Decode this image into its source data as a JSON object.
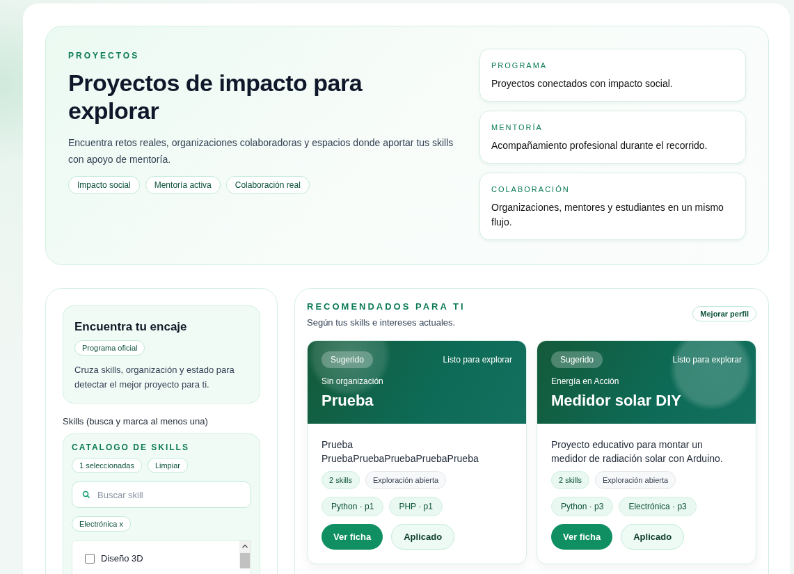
{
  "hero": {
    "eyebrow": "PROYECTOS",
    "title": "Proyectos de impacto para explorar",
    "description": "Encuentra retos reales, organizaciones colaboradoras y espacios donde aportar tus skills con apoyo de mentoría.",
    "tags": [
      "Impacto social",
      "Mentoría activa",
      "Colaboración real"
    ],
    "highlights": [
      {
        "label": "PROGRAMA",
        "text": "Proyectos conectados con impacto social."
      },
      {
        "label": "MENTORÍA",
        "text": "Acompañamiento profesional durante el recorrido."
      },
      {
        "label": "COLABORACIÓN",
        "text": "Organizaciones, mentores y estudiantes en un mismo flujo."
      }
    ]
  },
  "filters": {
    "title": "Encuentra tu encaje",
    "badge": "Programa oficial",
    "description": "Cruza skills, organización y estado para detectar el mejor proyecto para ti.",
    "skills_label": "Skills (busca y marca al menos una)",
    "catalog": {
      "title": "CATALOGO DE SKILLS",
      "selected_count": "1 seleccionadas",
      "clear": "Limpiar",
      "search": {
        "placeholder": "Buscar skill"
      },
      "chips": [
        "Electrónica x"
      ],
      "options": [
        {
          "label": "Diseño 3D",
          "checked": false
        }
      ]
    }
  },
  "recommended": {
    "title": "RECOMENDADOS PARA TI",
    "subtitle": "Según tus skills e intereses actuales.",
    "action": "Mejorar perfil",
    "projects": [
      {
        "badge": "Sugerido",
        "status": "Listo para explorar",
        "organization": "Sin organización",
        "name": "Prueba",
        "description": "Prueba PruebaPruebaPruebaPruebaPrueba",
        "skills_count": "2 skills",
        "mode": "Exploración abierta",
        "skills": [
          "Python · p1",
          "PHP · p1"
        ],
        "primary": "Ver ficha",
        "secondary": "Aplicado"
      },
      {
        "badge": "Sugerido",
        "status": "Listo para explorar",
        "organization": "Energía en Acción",
        "name": "Medidor solar DIY",
        "description": "Proyecto educativo para montar un medidor de radiación solar con Arduino.",
        "skills_count": "2 skills",
        "mode": "Exploración abierta",
        "skills": [
          "Python · p3",
          "Electrónica · p3"
        ],
        "primary": "Ver ficha",
        "secondary": "Aplicado"
      }
    ]
  }
}
